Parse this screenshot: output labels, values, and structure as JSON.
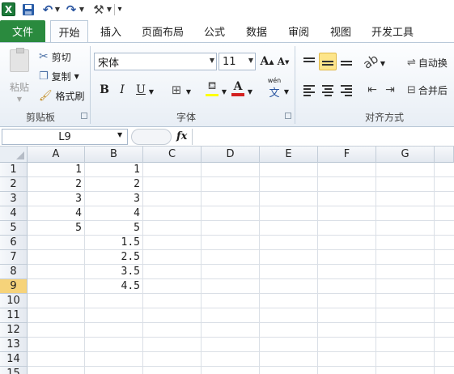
{
  "qat": {
    "logo": "X",
    "undo_glyph": "↶",
    "redo_glyph": "↷",
    "more_glyph": "⚒",
    "customize_glyph": "▾"
  },
  "tabs": {
    "file": "文件",
    "items": [
      {
        "label": "开始"
      },
      {
        "label": "插入"
      },
      {
        "label": "页面布局"
      },
      {
        "label": "公式"
      },
      {
        "label": "数据"
      },
      {
        "label": "审阅"
      },
      {
        "label": "视图"
      },
      {
        "label": "开发工具"
      }
    ]
  },
  "clipboard": {
    "paste": "粘贴",
    "cut": "剪切",
    "copy": "复制",
    "format_painter": "格式刷",
    "group": "剪贴板"
  },
  "font": {
    "name": "宋体",
    "size": "11",
    "grow": "A",
    "shrink": "A",
    "bold": "B",
    "italic": "I",
    "underline": "U",
    "font_color": "A",
    "phonetic": "文",
    "phonetic_sup": "wén",
    "group": "字体"
  },
  "alignment": {
    "wrap": "自动换",
    "merge": "合并后",
    "group": "对齐方式"
  },
  "formula_bar": {
    "name_box": "L9",
    "fx": "fx",
    "value": ""
  },
  "sheet": {
    "columns": [
      "A",
      "B",
      "C",
      "D",
      "E",
      "F",
      "G"
    ],
    "rows": [
      {
        "num": "1",
        "A": "1",
        "B": "1"
      },
      {
        "num": "2",
        "A": "2",
        "B": "2"
      },
      {
        "num": "3",
        "A": "3",
        "B": "3"
      },
      {
        "num": "4",
        "A": "4",
        "B": "4"
      },
      {
        "num": "5",
        "A": "5",
        "B": "5"
      },
      {
        "num": "6",
        "A": "",
        "B": "1.5"
      },
      {
        "num": "7",
        "A": "",
        "B": "2.5"
      },
      {
        "num": "8",
        "A": "",
        "B": "3.5"
      },
      {
        "num": "9",
        "A": "",
        "B": "4.5"
      },
      {
        "num": "10",
        "A": "",
        "B": ""
      },
      {
        "num": "11",
        "A": "",
        "B": ""
      },
      {
        "num": "12",
        "A": "",
        "B": ""
      },
      {
        "num": "13",
        "A": "",
        "B": ""
      },
      {
        "num": "14",
        "A": "",
        "B": ""
      },
      {
        "num": "15",
        "A": "",
        "B": ""
      }
    ],
    "selected_row": "9"
  },
  "colors": {
    "file_tab": "#2a8a3e",
    "selected_row_header": "#f6d37a",
    "highlight_yellow": "#fde58a",
    "font_red": "#d32020"
  }
}
